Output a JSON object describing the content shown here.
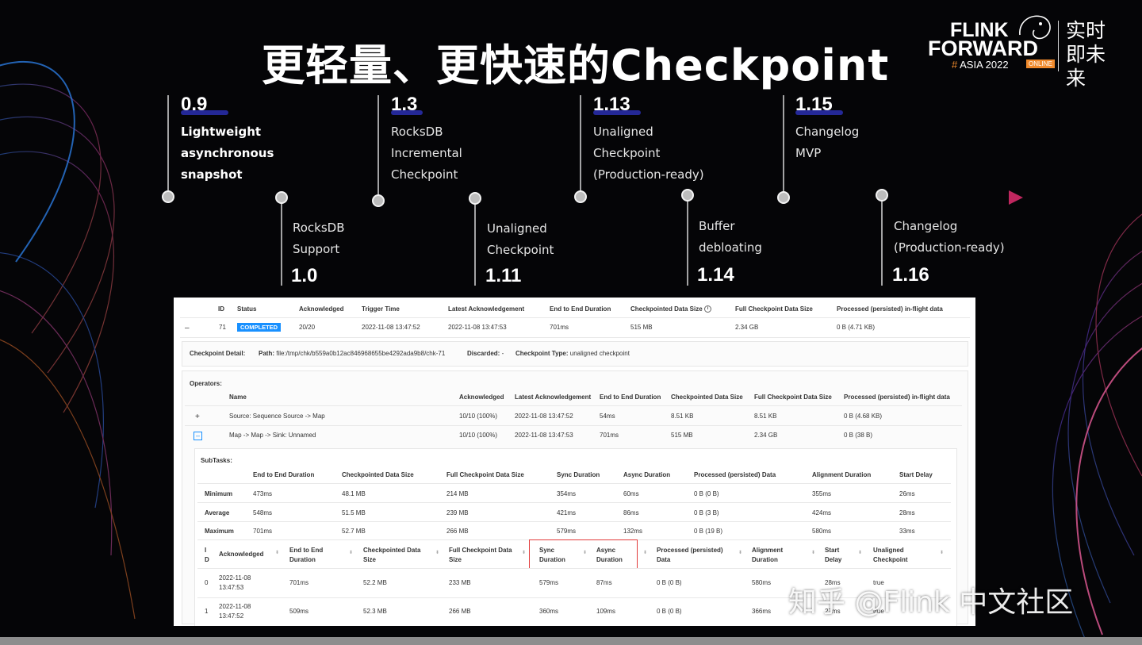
{
  "slide": {
    "title": "更轻量、更快速的Checkpoint"
  },
  "logo": {
    "line1": "FLINK",
    "line2": "FORWARD",
    "line3_hash": "#",
    "line3_text": "ASIA 2022",
    "badge": "ONLINE",
    "cn": "实时即未来"
  },
  "timeline": {
    "top": [
      {
        "version": "0.9",
        "label": "Lightweight\nasynchronous\nsnapshot"
      },
      {
        "version": "1.3",
        "label": "RocksDB\nIncremental\nCheckpoint"
      },
      {
        "version": "1.13",
        "label": "Unaligned\nCheckpoint\n(Production-ready)"
      },
      {
        "version": "1.15",
        "label": "Changelog\nMVP"
      }
    ],
    "bottom": [
      {
        "version": "1.0",
        "label": "RocksDB\nSupport"
      },
      {
        "version": "1.11",
        "label": "Unaligned\nCheckpoint"
      },
      {
        "version": "1.14",
        "label": "Buffer\ndebloating"
      },
      {
        "version": "1.16",
        "label": "Changelog\n(Production-ready)"
      }
    ]
  },
  "checkpoint_table": {
    "headers": [
      "ID",
      "Status",
      "Acknowledged",
      "Trigger Time",
      "Latest Acknowledgement",
      "End to End Duration",
      "Checkpointed Data Size",
      "Full Checkpoint Data Size",
      "Processed (persisted) in-flight data"
    ],
    "row": {
      "toggle": "–",
      "id": "71",
      "status": "COMPLETED",
      "acknowledged": "20/20",
      "trigger_time": "2022-11-08 13:47:52",
      "latest_ack": "2022-11-08 13:47:53",
      "e2e": "701ms",
      "checkpointed": "515 MB",
      "full": "2.34 GB",
      "processed": "0 B (4.71 KB)"
    },
    "info_icon": "info-icon"
  },
  "detail": {
    "label": "Checkpoint Detail:",
    "path_label": "Path:",
    "path": "file:/tmp/chk/b559a0b12ac846968655be4292ada9b8/chk-71",
    "discarded_label": "Discarded:",
    "discarded": "-",
    "type_label": "Checkpoint Type:",
    "type": "unaligned checkpoint"
  },
  "operators": {
    "label": "Operators:",
    "headers": [
      "Name",
      "Acknowledged",
      "Latest Acknowledgement",
      "End to End Duration",
      "Checkpointed Data Size",
      "Full Checkpoint Data Size",
      "Processed (persisted) in-flight data"
    ],
    "rows": [
      {
        "toggle": "+",
        "name": "Source: Sequence Source -> Map",
        "ack": "10/10 (100%)",
        "latest": "2022-11-08 13:47:52",
        "e2e": "54ms",
        "checkpointed": "8.51 KB",
        "full": "8.51 KB",
        "processed": "0 B (4.68 KB)"
      },
      {
        "toggle": "–",
        "name": "Map -> Map -> Sink: Unnamed",
        "ack": "10/10 (100%)",
        "latest": "2022-11-08 13:47:53",
        "e2e": "701ms",
        "checkpointed": "515 MB",
        "full": "2.34 GB",
        "processed": "0 B (38 B)"
      }
    ]
  },
  "subtasks": {
    "label": "SubTasks:",
    "summary_headers": [
      "End to End Duration",
      "Checkpointed Data Size",
      "Full Checkpoint Data Size",
      "Sync Duration",
      "Async Duration",
      "Processed (persisted) Data",
      "Alignment Duration",
      "Start Delay"
    ],
    "summary_rows": [
      {
        "label": "Minimum",
        "values": [
          "473ms",
          "48.1 MB",
          "214 MB",
          "354ms",
          "60ms",
          "0 B (0 B)",
          "355ms",
          "26ms"
        ]
      },
      {
        "label": "Average",
        "values": [
          "548ms",
          "51.5 MB",
          "239 MB",
          "421ms",
          "86ms",
          "0 B (3 B)",
          "424ms",
          "28ms"
        ]
      },
      {
        "label": "Maximum",
        "values": [
          "701ms",
          "52.7 MB",
          "266 MB",
          "579ms",
          "132ms",
          "0 B (19 B)",
          "580ms",
          "33ms"
        ]
      }
    ],
    "detail_headers": {
      "id1": "I",
      "id2": "D",
      "ack": "Acknowledged",
      "e2e1": "End to End",
      "e2e2": "Duration",
      "cp1": "Checkpointed Data",
      "cp2": "Size",
      "full1": "Full Checkpoint Data",
      "full2": "Size",
      "sync1": "Sync",
      "sync2": "Duration",
      "async1": "Async",
      "async2": "Duration",
      "proc1": "Processed (persisted)",
      "proc2": "Data",
      "align1": "Alignment",
      "align2": "Duration",
      "start1": "Start",
      "start2": "Delay",
      "unal1": "Unaligned",
      "unal2": "Checkpoint"
    },
    "detail_rows": [
      {
        "id": "0",
        "ack1": "2022-11-08",
        "ack2": "13:47:53",
        "e2e": "701ms",
        "cp": "52.2 MB",
        "full": "233 MB",
        "sync": "579ms",
        "async": "87ms",
        "proc": "0 B (0 B)",
        "align": "580ms",
        "start": "28ms",
        "unal": "true"
      },
      {
        "id": "1",
        "ack1": "2022-11-08",
        "ack2": "13:47:52",
        "e2e": "509ms",
        "cp": "52.3 MB",
        "full": "266 MB",
        "sync": "360ms",
        "async": "109ms",
        "proc": "0 B (0 B)",
        "align": "366ms",
        "start": "27ms",
        "unal": "true"
      }
    ]
  },
  "watermark": "知乎 @Flink 中文社区"
}
